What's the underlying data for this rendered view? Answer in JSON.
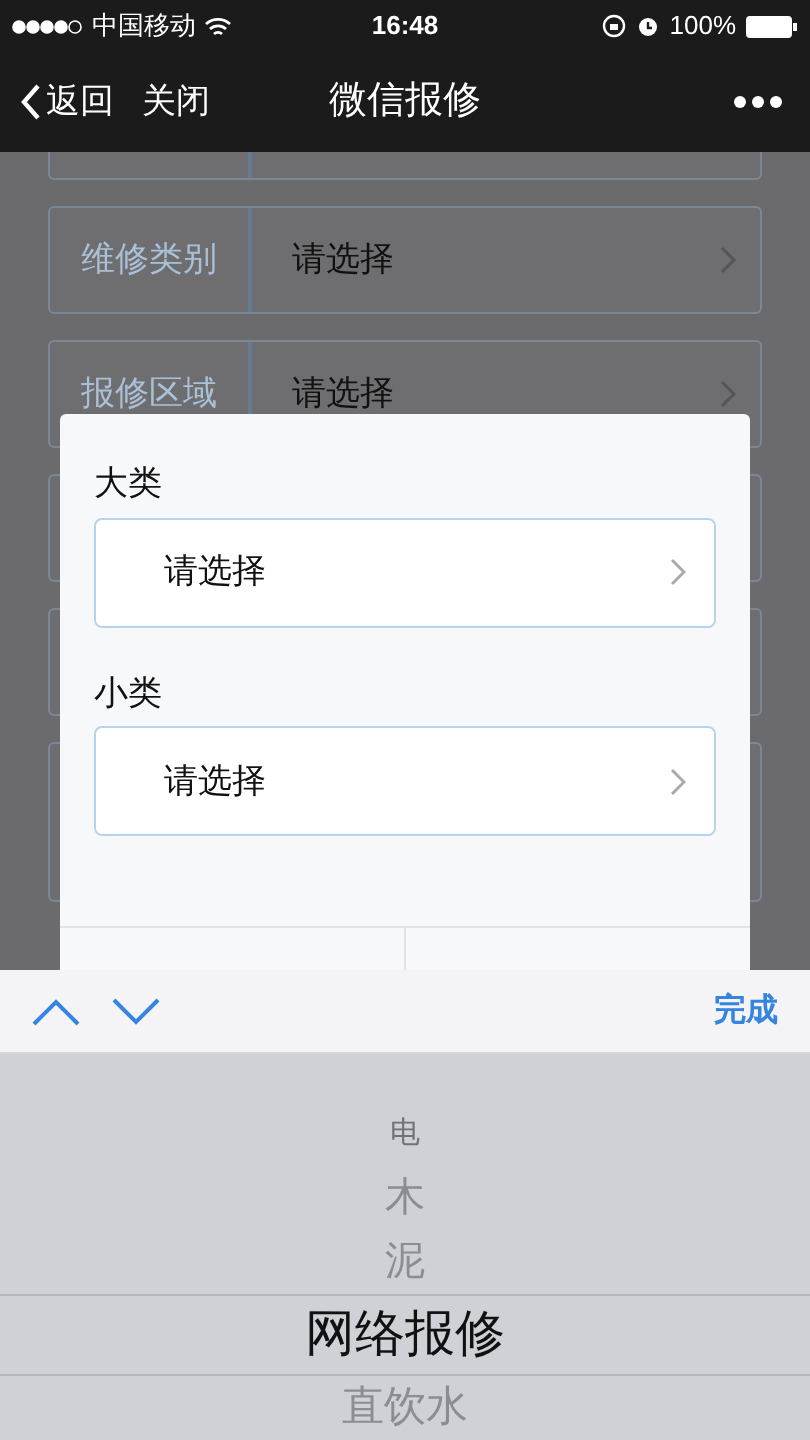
{
  "status_bar": {
    "carrier": "中国移动",
    "time": "16:48",
    "battery": "100%"
  },
  "nav": {
    "back": "返回",
    "close": "关闭",
    "title": "微信报修"
  },
  "form_rows": [
    {
      "label": "",
      "placeholder": ""
    },
    {
      "label": "维修类别",
      "placeholder": "请选择"
    },
    {
      "label": "报修区域",
      "placeholder": "请选择"
    },
    {
      "label": "",
      "placeholder": ""
    },
    {
      "label": "",
      "placeholder": ""
    },
    {
      "label": "",
      "placeholder": ""
    }
  ],
  "dialog": {
    "fields": [
      {
        "label": "大类",
        "placeholder": "请选择"
      },
      {
        "label": "小类",
        "placeholder": "请选择"
      }
    ]
  },
  "picker": {
    "done": "完成",
    "items": [
      {
        "label": "电",
        "selected": false
      },
      {
        "label": "木",
        "selected": false
      },
      {
        "label": "泥",
        "selected": false
      },
      {
        "label": "网络报修",
        "selected": true
      },
      {
        "label": "直饮水",
        "selected": false
      }
    ]
  }
}
